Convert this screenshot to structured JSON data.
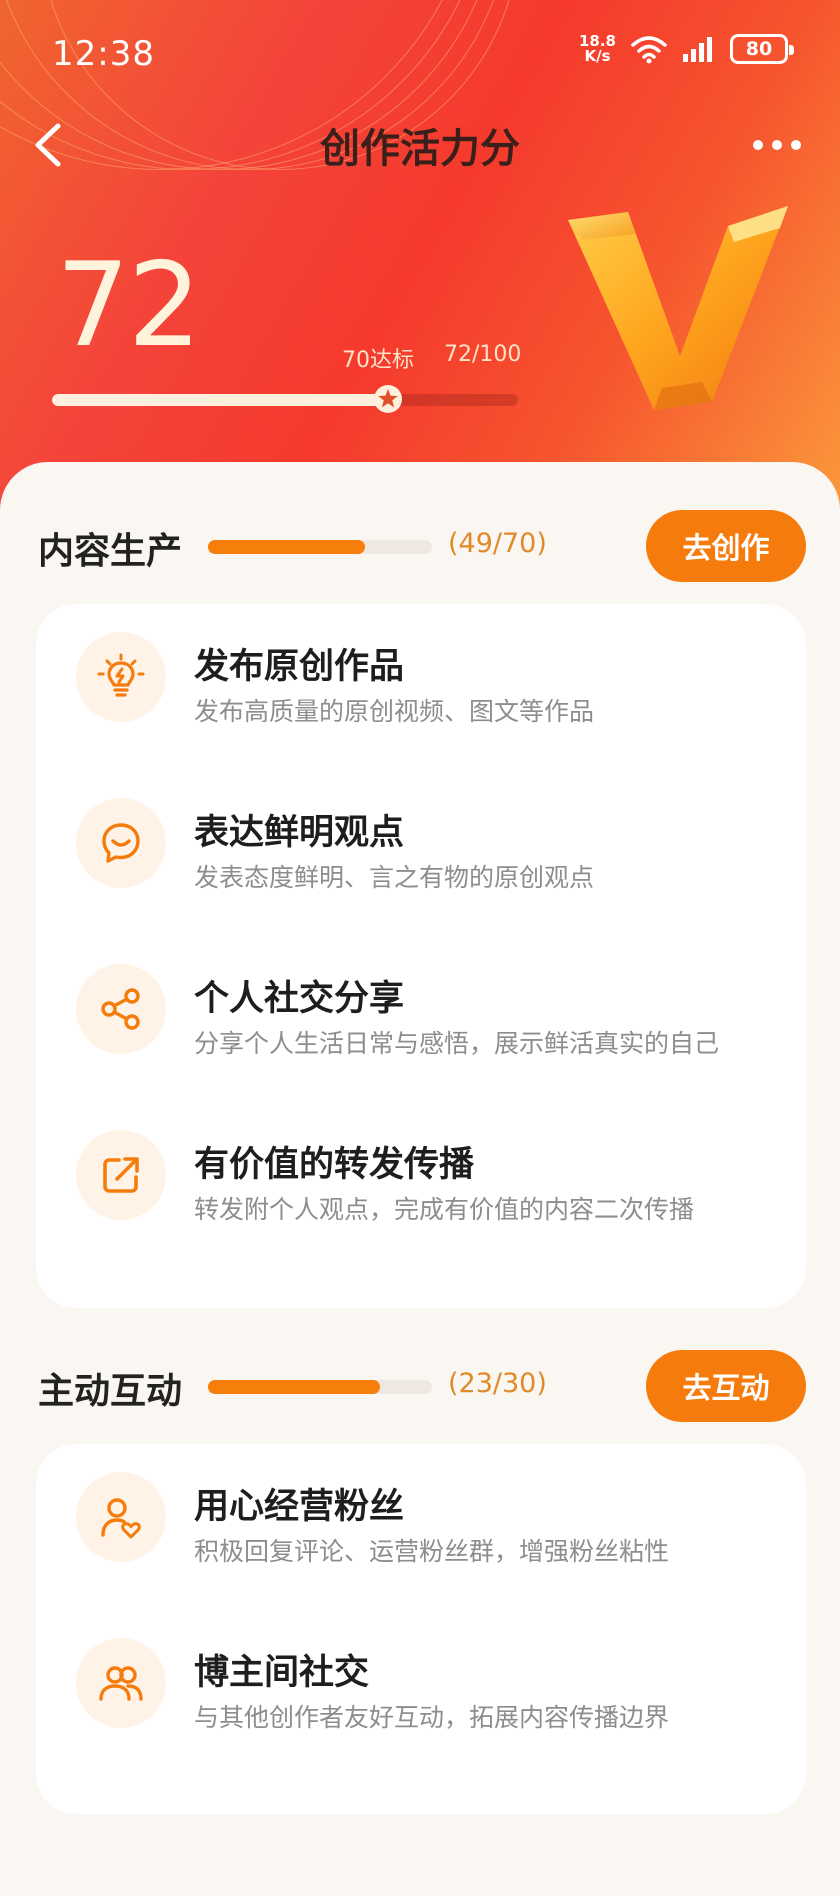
{
  "status_bar": {
    "time": "12:38",
    "net_speed_value": "18.8",
    "net_speed_unit": "K/s",
    "battery": "80"
  },
  "nav": {
    "title": "创作活力分"
  },
  "hero": {
    "score": "72",
    "target_label": "70达标",
    "progress_label": "72/100",
    "progress_fraction": 0.72
  },
  "sections": [
    {
      "title": "内容生产",
      "count": "(49/70)",
      "progress_fraction": 0.7,
      "button_label": "去创作",
      "items": [
        {
          "icon": "lightbulb-icon",
          "title": "发布原创作品",
          "desc": "发布高质量的原创视频、图文等作品"
        },
        {
          "icon": "chat-bubble-icon",
          "title": "表达鲜明观点",
          "desc": "发表态度鲜明、言之有物的原创观点"
        },
        {
          "icon": "share-icon",
          "title": "个人社交分享",
          "desc": "分享个人生活日常与感悟，展示鲜活真实的自己"
        },
        {
          "icon": "forward-icon",
          "title": "有价值的转发传播",
          "desc": "转发附个人观点，完成有价值的内容二次传播"
        }
      ]
    },
    {
      "title": "主动互动",
      "count": "(23/30)",
      "progress_fraction": 0.767,
      "button_label": "去互动",
      "items": [
        {
          "icon": "user-heart-icon",
          "title": "用心经营粉丝",
          "desc": "积极回复评论、运营粉丝群，增强粉丝粘性"
        },
        {
          "icon": "users-icon",
          "title": "博主间社交",
          "desc": "与其他创作者友好互动，拓展内容传播边界"
        }
      ]
    }
  ],
  "colors": {
    "accent": "#f57c0c",
    "hero_red": "#f53a2d",
    "icon_bg": "#fff3e7",
    "desc_gray": "#8d8d8d"
  }
}
